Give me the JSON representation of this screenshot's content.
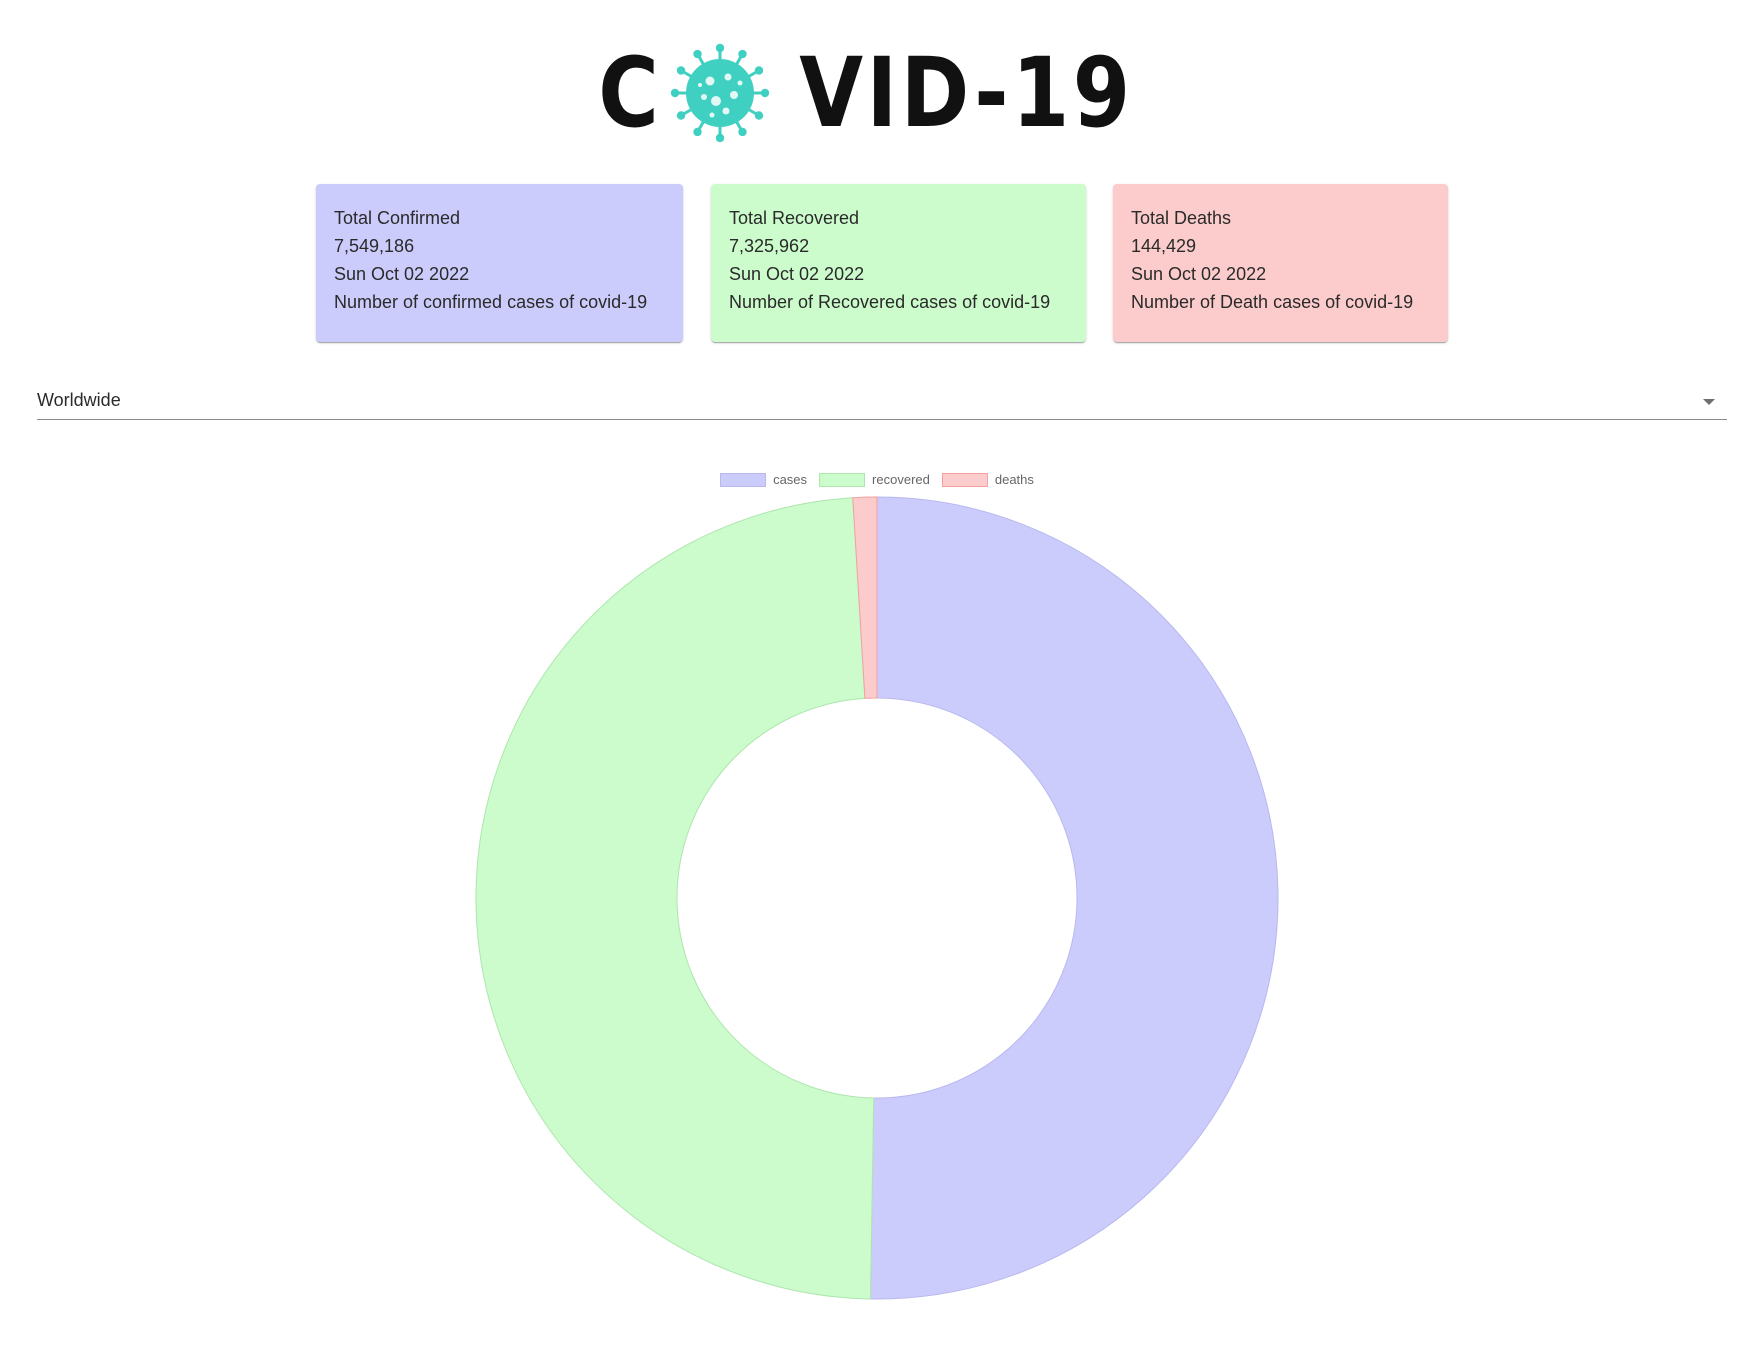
{
  "logo": {
    "text_left": "C",
    "text_right": "VID-19",
    "virus_icon": "coronavirus-icon",
    "virus_color": "#3fd0c2"
  },
  "cards": [
    {
      "title": "Total Confirmed",
      "value": "7,549,186",
      "date": "Sun Oct 02 2022",
      "description": "Number of confirmed cases of covid-19",
      "color": "#ccccfc"
    },
    {
      "title": "Total Recovered",
      "value": "7,325,962",
      "date": "Sun Oct 02 2022",
      "description": "Number of Recovered cases of covid-19",
      "color": "#ccfccc"
    },
    {
      "title": "Total Deaths",
      "value": "144,429",
      "date": "Sun Oct 02 2022",
      "description": "Number of Death cases of covid-19",
      "color": "#fccccc"
    }
  ],
  "country_select": {
    "value": "Worldwide",
    "icon": "chevron-down-icon"
  },
  "chart_data": {
    "type": "pie",
    "variant": "doughnut",
    "categories": [
      "cases",
      "recovered",
      "deaths"
    ],
    "values": [
      7549186,
      7325962,
      144429
    ],
    "colors": [
      "#ccccfc",
      "#ccfccc",
      "#fccccc"
    ],
    "border_colors": [
      "#b8b8ef",
      "#aee6ae",
      "#f2a0a0"
    ],
    "legend_position": "top",
    "title": ""
  }
}
